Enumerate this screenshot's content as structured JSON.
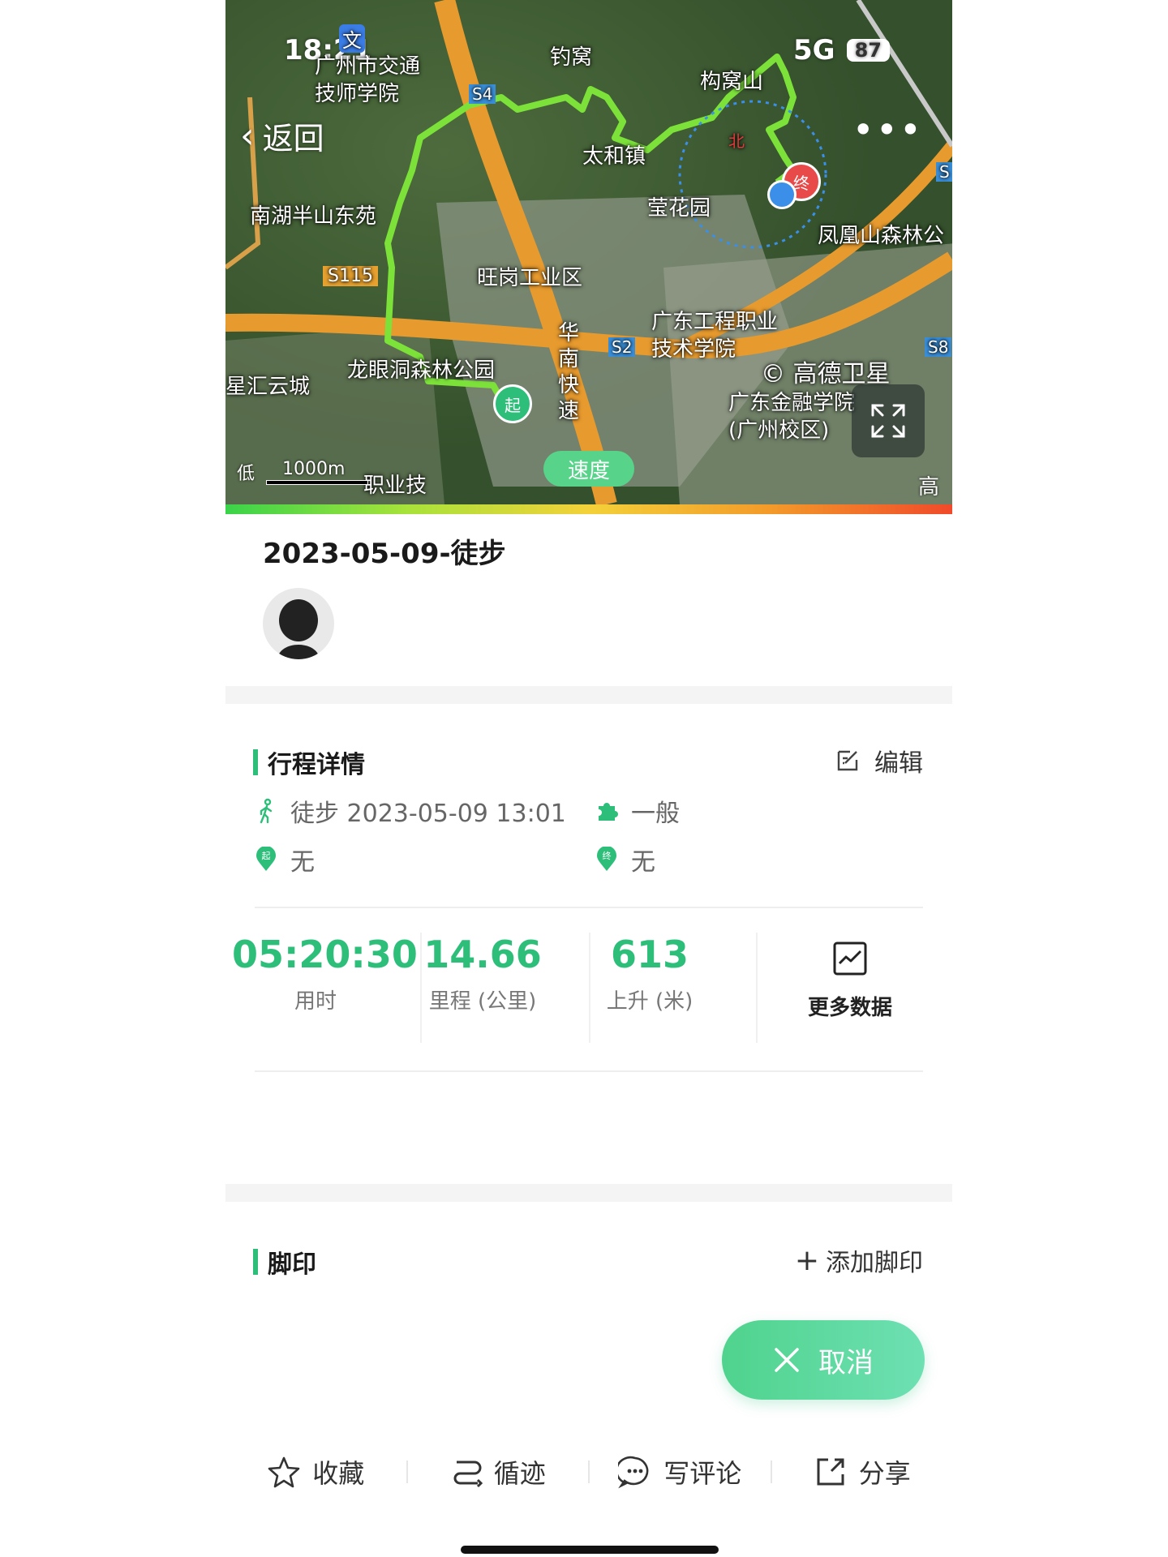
{
  "status_bar": {
    "time": "18:21",
    "signal": "5G",
    "battery": "87"
  },
  "nav": {
    "back_label": "返回"
  },
  "map": {
    "labels": {
      "wen": "文",
      "school1": "广州市交通技师学院",
      "diaowo": "钓窝",
      "gouwo": "构窝山",
      "tuyuan": "太和镇",
      "yinghua": "莹花园",
      "nanhu": "南湖半山东苑",
      "wanggang": "旺岗工业区",
      "fenghuang": "凤凰山森林公",
      "gongcheng": "广东工程职业技术学院",
      "gaode": "© 高德卫星",
      "longyan": "龙眼洞森林公园",
      "jinrong": "广东金融学院(广州校区)",
      "xinghui": "星汇云城",
      "huanan": "华南快速",
      "tail_text": "职业技",
      "s115": "S115",
      "s4": "S4",
      "s2": "S2",
      "s8": "S8",
      "s5": "S",
      "north": "北"
    },
    "start_label": "起",
    "end_label": "终",
    "speed_label": "速度",
    "scale_low": "低",
    "scale_distance": "1000m",
    "scale_high": "高"
  },
  "trip": {
    "title": "2023-05-09-徒步",
    "section_title": "行程详情",
    "edit_label": "编辑",
    "type_time": "徒步 2023-05-09 13:01",
    "difficulty": "一般",
    "start_place": "无",
    "end_place": "无"
  },
  "stats": [
    {
      "value": "05:20:30",
      "label": "用时"
    },
    {
      "value": "14.66",
      "label": "里程 (公里)"
    },
    {
      "value": "613",
      "label": "上升 (米)"
    }
  ],
  "more_data_label": "更多数据",
  "footprint": {
    "title": "脚印",
    "add_label": "添加脚印"
  },
  "cancel_label": "取消",
  "bottom_bar": {
    "favorite": "收藏",
    "follow_track": "循迹",
    "comment": "写评论",
    "share": "分享"
  },
  "colors": {
    "accent": "#2dbf7a",
    "track": "#7ce23a"
  }
}
